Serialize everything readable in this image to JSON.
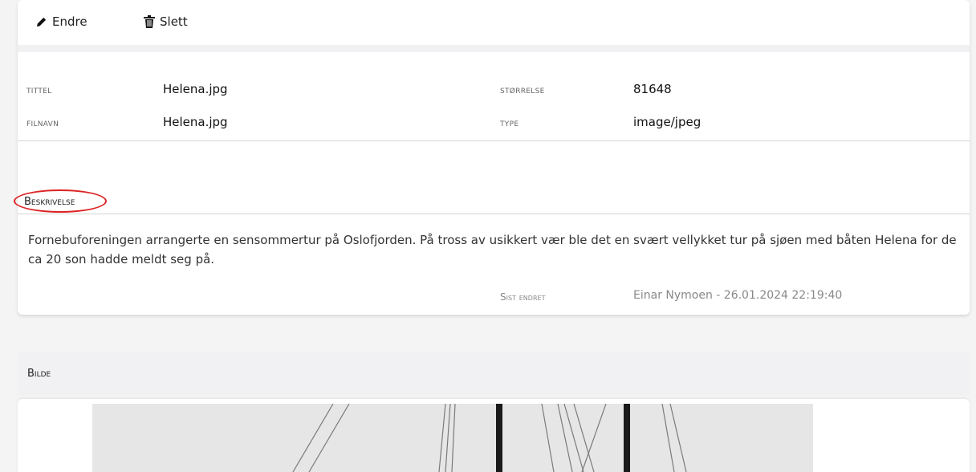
{
  "toolbar": {
    "edit_label": "Endre",
    "edit_icon": "pencil-icon",
    "delete_label": "Slett",
    "delete_icon": "trash-icon"
  },
  "details": {
    "title_label": "Tittel",
    "title_value": "Helena.jpg",
    "filename_label": "Filnavn",
    "filename_value": "Helena.jpg",
    "size_label": "Størrelse",
    "size_value": "81648",
    "type_label": "Type",
    "type_value": "image/jpeg"
  },
  "description": {
    "heading": "Beskrivelse",
    "highlight_color": "#dd2222",
    "text": "Fornebuforeningen arrangerte en sensommertur på Oslofjorden. På tross av usikkert vær ble det en svært vellykket tur på sjøen med båten Helena for de ca 20 son hadde meldt seg på."
  },
  "last_modified": {
    "label": "Sist endret",
    "value": "Einar Nymoen - 26.01.2024 22:19:40"
  },
  "image_section": {
    "heading": "Bilde"
  }
}
